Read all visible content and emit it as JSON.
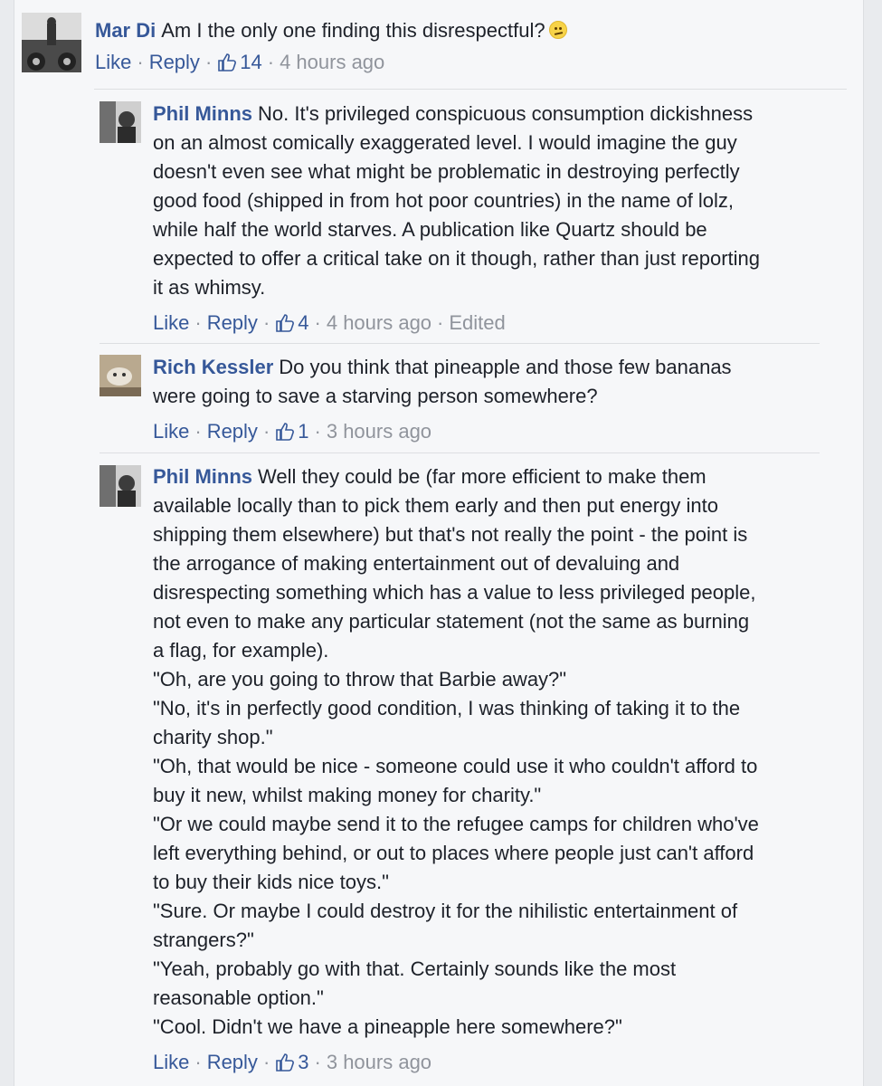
{
  "comments": [
    {
      "author": "Mar Di",
      "text": "Am I the only one finding this disrespectful?",
      "emoji": "confused-face",
      "actions": {
        "like": "Like",
        "reply": "Reply",
        "likes": "14",
        "time": "4 hours ago"
      }
    },
    {
      "author": "Phil Minns",
      "text": "No. It's privileged conspicuous consumption dickishness\non an almost comically exaggerated level. I would imagine the guy\ndoesn't even see what might be problematic in destroying perfectly\ngood food (shipped in from hot poor countries) in the name of lolz,\nwhile half the world starves. A publication like Quartz should be\nexpected to offer a critical take on it though, rather than just reporting\nit as whimsy.",
      "actions": {
        "like": "Like",
        "reply": "Reply",
        "likes": "4",
        "time": "4 hours ago",
        "edited": "Edited"
      }
    },
    {
      "author": "Rich Kessler",
      "text": "Do you think that pineapple and those few bananas\nwere going to save a starving person somewhere?",
      "actions": {
        "like": "Like",
        "reply": "Reply",
        "likes": "1",
        "time": "3 hours ago"
      }
    },
    {
      "author": "Phil Minns",
      "text": "Well they could be (far more efficient to make them\navailable locally than to pick them early and then put energy into\nshipping them elsewhere) but that's not really the point - the point is\nthe arrogance of making entertainment out of devaluing and\ndisrespecting something which has a value to less privileged people,\nnot even to make any particular statement (not the same as burning\na flag, for example).\n\"Oh, are you going to throw that Barbie away?\"\n\"No, it's in perfectly good condition, I was thinking of taking it to the\ncharity shop.\"\n\"Oh, that would be nice - someone could use it who couldn't afford to\nbuy it new, whilst making money for charity.\"\n\"Or we could maybe send it to the refugee camps for children who've\nleft everything behind, or out to places where people just can't afford\nto buy their kids nice toys.\"\n\"Sure. Or maybe I could destroy it for the nihilistic entertainment of\nstrangers?\"\n\"Yeah, probably go with that. Certainly sounds like the most\nreasonable option.\"\n\"Cool. Didn't we have a pineapple here somewhere?\"",
      "actions": {
        "like": "Like",
        "reply": "Reply",
        "likes": "3",
        "time": "3 hours ago"
      }
    }
  ],
  "colors": {
    "link": "#365899",
    "meta": "#90949c",
    "text": "#1d2129"
  }
}
